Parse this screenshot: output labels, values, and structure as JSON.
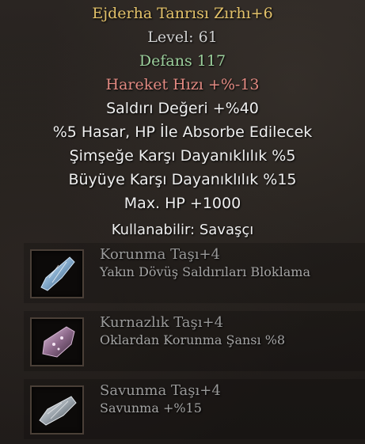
{
  "item": {
    "title": "Ejderha Tanrısı Zırhı+6",
    "level": "Level: 61",
    "defense": "Defans 117",
    "move_speed": "Hareket Hızı +%-13",
    "attack_value": "Saldırı Değeri +%40",
    "hp_absorb": "%5 Hasar, HP İle Absorbe Edilecek",
    "lightning_resist": "Şimşeğe Karşı Dayanıklılık %5",
    "magic_resist": "Büyüye Karşı Dayanıklılık %15",
    "max_hp": "Max. HP +1000",
    "usable_label": "Kullanabilir:",
    "usable_class": "Savaşçı"
  },
  "stones": [
    {
      "name": "Korunma Taşı+4",
      "desc": "Yakın Dövüş Saldırıları Bloklama",
      "icon": "blue-stone-icon"
    },
    {
      "name": "Kurnazlık Taşı+4",
      "desc": "Oklardan Korunma Şansı %8",
      "icon": "purple-stone-icon"
    },
    {
      "name": "Savunma Taşı+4",
      "desc": "Savunma +%15",
      "icon": "silver-stone-icon"
    }
  ],
  "colors": {
    "title": "#e3c26a",
    "defense": "#9ccf9c",
    "penalty": "#e28a82",
    "bonus": "#efefef"
  }
}
